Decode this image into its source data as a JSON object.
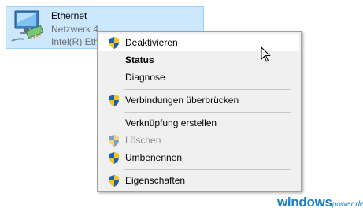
{
  "adapter": {
    "name": "Ethernet",
    "network": "Netzwerk 4",
    "device": "Intel(R) Ethe",
    "icon": "network-adapter-icon"
  },
  "menu": {
    "items": [
      {
        "label": "Deaktivieren",
        "shield": true,
        "bold": false,
        "disabled": false,
        "hovered": true
      },
      {
        "label": "Status",
        "shield": false,
        "bold": true,
        "disabled": false
      },
      {
        "label": "Diagnose",
        "shield": false,
        "bold": false,
        "disabled": false
      },
      {
        "label": "Verbindungen überbrücken",
        "shield": true,
        "bold": false,
        "disabled": false
      },
      {
        "label": "Verknüpfung erstellen",
        "shield": false,
        "bold": false,
        "disabled": false
      },
      {
        "label": "Löschen",
        "shield": true,
        "bold": false,
        "disabled": true
      },
      {
        "label": "Umbenennen",
        "shield": true,
        "bold": false,
        "disabled": false
      },
      {
        "label": "Eigenschaften",
        "shield": true,
        "bold": false,
        "disabled": false
      }
    ]
  },
  "brand": {
    "main": "windows",
    "sub": "power.de"
  },
  "colors": {
    "selection": "#cce8ff",
    "menu_bg": "#f0f0f0",
    "brand": "#1a7fc4"
  }
}
